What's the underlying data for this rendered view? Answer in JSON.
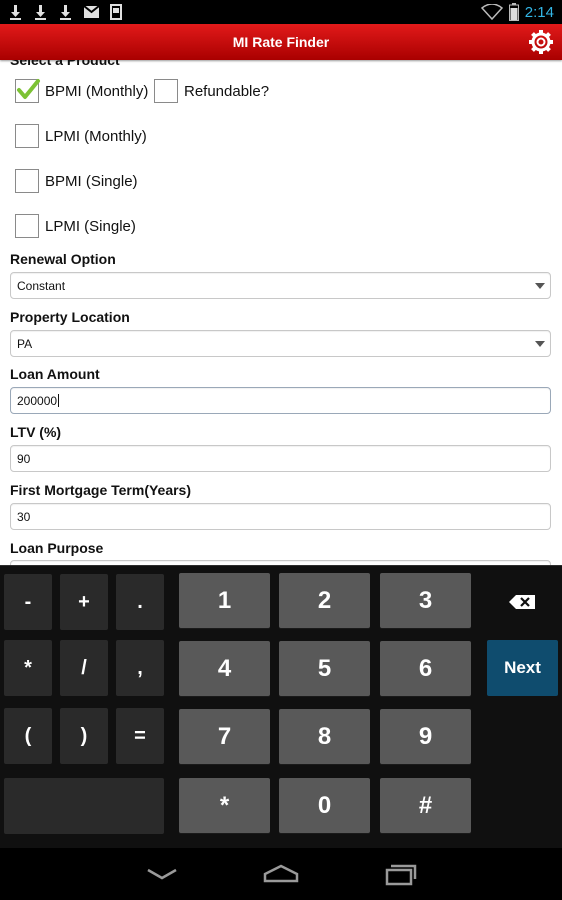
{
  "status_bar": {
    "time": "2:14",
    "left_icons": [
      "download-icon",
      "download-icon",
      "download-icon",
      "gmail-icon",
      "sd-card-icon"
    ],
    "right_icons": [
      "wifi-icon",
      "battery-icon"
    ]
  },
  "title_bar": {
    "title": "MI Rate Finder",
    "settings_icon": "gear-icon",
    "color": "#c80a0a"
  },
  "product": {
    "section_title": "Select a Product",
    "options": [
      {
        "label": "BPMI (Monthly)",
        "checked": true
      },
      {
        "label": "Refundable?",
        "checked": false
      },
      {
        "label": "LPMI (Monthly)",
        "checked": false
      },
      {
        "label": "BPMI (Single)",
        "checked": false
      },
      {
        "label": "LPMI (Single)",
        "checked": false
      }
    ]
  },
  "fields": {
    "renewal_option": {
      "label": "Renewal Option",
      "value": "Constant"
    },
    "property_location": {
      "label": "Property Location",
      "value": "PA"
    },
    "loan_amount": {
      "label": "Loan Amount",
      "value": "200000"
    },
    "ltv": {
      "label": "LTV (%)",
      "value": "90"
    },
    "first_mortgage_term": {
      "label": "First Mortgage Term(Years)",
      "value": "30"
    },
    "loan_purpose": {
      "label": "Loan Purpose",
      "value": ""
    }
  },
  "keyboard": {
    "symbols": [
      "-",
      "+",
      ".",
      "*",
      "/",
      ",",
      "(",
      ")",
      "="
    ],
    "digits": [
      "1",
      "2",
      "3",
      "4",
      "5",
      "6",
      "7",
      "8",
      "9",
      "*",
      "0",
      "#"
    ],
    "next_label": "Next",
    "next_color": "#0f4c6e",
    "backspace_icon": "backspace-icon"
  },
  "nav_bar": {
    "icons": [
      "back-icon",
      "home-icon",
      "recent-apps-icon"
    ]
  }
}
